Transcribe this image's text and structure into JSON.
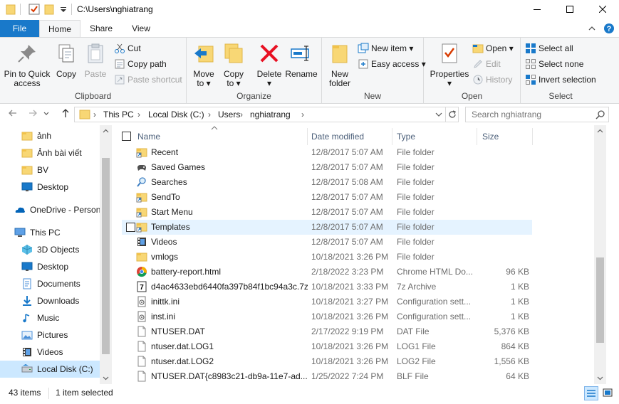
{
  "window": {
    "title": "C:\\Users\\nghiatrang",
    "minimize_glyph": "—",
    "maximize_glyph": "☐",
    "close_glyph": "✕",
    "help_glyph": "?",
    "collapse_glyph": "⌃"
  },
  "ribbon_tabs": [
    "File",
    "Home",
    "Share",
    "View"
  ],
  "ribbon": {
    "clipboard": {
      "label": "Clipboard",
      "pin_label_1": "Pin to Quick",
      "pin_label_2": "access",
      "copy_label": "Copy",
      "paste_label": "Paste",
      "cut_label": "Cut",
      "copy_path_label": "Copy path",
      "paste_shortcut_label": "Paste shortcut"
    },
    "organize": {
      "label": "Organize",
      "move_to_1": "Move",
      "move_to_2": "to ▾",
      "copy_to_1": "Copy",
      "copy_to_2": "to ▾",
      "delete_1": "Delete",
      "delete_2": "▾",
      "rename_label": "Rename"
    },
    "new": {
      "label": "New",
      "new_folder_1": "New",
      "new_folder_2": "folder",
      "new_item_label": "New item ▾",
      "easy_access_label": "Easy access ▾"
    },
    "open": {
      "label": "Open",
      "properties_1": "Properties",
      "properties_2": "▾",
      "open_label": "Open ▾",
      "edit_label": "Edit",
      "history_label": "History"
    },
    "select": {
      "label": "Select",
      "select_all_label": "Select all",
      "select_none_label": "Select none",
      "invert_label": "Invert selection"
    }
  },
  "address": {
    "crumbs": [
      "This PC",
      "Local Disk (C:)",
      "Users",
      "nghiatrang"
    ],
    "separator": "›",
    "search_placeholder": "Search nghiatrang"
  },
  "nav_pane": {
    "items": [
      {
        "label": "ảnh",
        "icon": "folder-icon"
      },
      {
        "label": "Ảnh bài viết",
        "icon": "folder-icon"
      },
      {
        "label": "BV",
        "icon": "folder-icon"
      },
      {
        "label": "Desktop",
        "icon": "desktop-icon"
      },
      {
        "label": "OneDrive - Personal",
        "icon": "onedrive-icon"
      },
      {
        "label": "This PC",
        "icon": "this-pc-icon"
      },
      {
        "label": "3D Objects",
        "icon": "3d-objects-icon"
      },
      {
        "label": "Desktop",
        "icon": "desktop-icon"
      },
      {
        "label": "Documents",
        "icon": "documents-icon"
      },
      {
        "label": "Downloads",
        "icon": "downloads-icon"
      },
      {
        "label": "Music",
        "icon": "music-icon"
      },
      {
        "label": "Pictures",
        "icon": "pictures-icon"
      },
      {
        "label": "Videos",
        "icon": "videos-icon"
      },
      {
        "label": "Local Disk (C:)",
        "icon": "local-disk-icon"
      }
    ]
  },
  "columns": {
    "name": "Name",
    "date": "Date modified",
    "type": "Type",
    "size": "Size"
  },
  "files": [
    {
      "name": "Recent",
      "date": "12/8/2017 5:07 AM",
      "type": "File folder",
      "size": "",
      "icon": "shortcut-folder-icon"
    },
    {
      "name": "Saved Games",
      "date": "12/8/2017 5:07 AM",
      "type": "File folder",
      "size": "",
      "icon": "saved-games-icon"
    },
    {
      "name": "Searches",
      "date": "12/8/2017 5:08 AM",
      "type": "File folder",
      "size": "",
      "icon": "searches-icon"
    },
    {
      "name": "SendTo",
      "date": "12/8/2017 5:07 AM",
      "type": "File folder",
      "size": "",
      "icon": "shortcut-folder-icon"
    },
    {
      "name": "Start Menu",
      "date": "12/8/2017 5:07 AM",
      "type": "File folder",
      "size": "",
      "icon": "shortcut-folder-icon"
    },
    {
      "name": "Templates",
      "date": "12/8/2017 5:07 AM",
      "type": "File folder",
      "size": "",
      "icon": "shortcut-folder-icon"
    },
    {
      "name": "Videos",
      "date": "12/8/2017 5:07 AM",
      "type": "File folder",
      "size": "",
      "icon": "videos-icon"
    },
    {
      "name": "vmlogs",
      "date": "10/18/2021 3:26 PM",
      "type": "File folder",
      "size": "",
      "icon": "folder-icon"
    },
    {
      "name": "battery-report.html",
      "date": "2/18/2022 3:23 PM",
      "type": "Chrome HTML Do...",
      "size": "96 KB",
      "icon": "chrome-icon"
    },
    {
      "name": "d4ac4633ebd6440fa397b84f1bc94a3c.7z",
      "date": "10/18/2021 3:33 PM",
      "type": "7z Archive",
      "size": "1 KB",
      "icon": "7z-icon"
    },
    {
      "name": "inittk.ini",
      "date": "10/18/2021 3:27 PM",
      "type": "Configuration sett...",
      "size": "1 KB",
      "icon": "ini-icon"
    },
    {
      "name": "inst.ini",
      "date": "10/18/2021 3:26 PM",
      "type": "Configuration sett...",
      "size": "1 KB",
      "icon": "ini-icon"
    },
    {
      "name": "NTUSER.DAT",
      "date": "2/17/2022 9:19 PM",
      "type": "DAT File",
      "size": "5,376 KB",
      "icon": "file-icon"
    },
    {
      "name": "ntuser.dat.LOG1",
      "date": "10/18/2021 3:26 PM",
      "type": "LOG1 File",
      "size": "864 KB",
      "icon": "file-icon"
    },
    {
      "name": "ntuser.dat.LOG2",
      "date": "10/18/2021 3:26 PM",
      "type": "LOG2 File",
      "size": "1,556 KB",
      "icon": "file-icon"
    },
    {
      "name": "NTUSER.DAT{c8983c21-db9a-11e7-ad...",
      "date": "1/25/2022 7:24 PM",
      "type": "BLF File",
      "size": "64 KB",
      "icon": "file-icon"
    }
  ],
  "status": {
    "items_count": "43 items",
    "selected": "1 item selected"
  },
  "colors": {
    "file_tab": "#1979ca",
    "folder_yellow": "#f8d775",
    "selection": "#cce8ff",
    "hover": "#e5f3ff",
    "delete_red": "#e81123"
  }
}
